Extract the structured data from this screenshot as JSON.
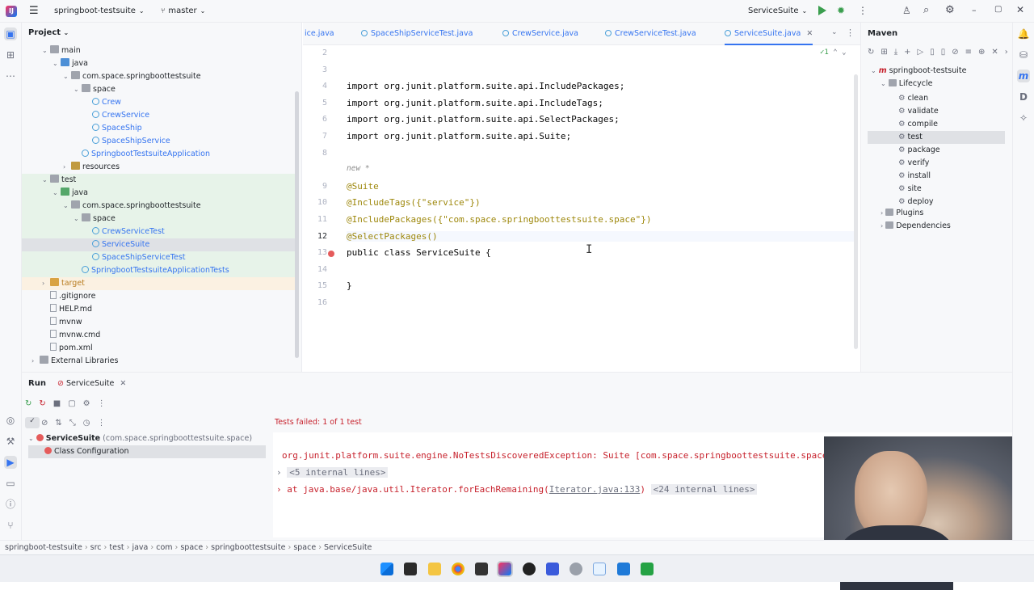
{
  "titlebar": {
    "project": "springboot-testsuite",
    "branch": "master",
    "run_config": "ServiceSuite"
  },
  "project_panel": {
    "title": "Project",
    "tree": [
      {
        "label": "main",
        "indent": 1,
        "type": "folder"
      },
      {
        "label": "java",
        "indent": 2,
        "type": "src"
      },
      {
        "label": "com.space.springboottestsuite",
        "indent": 3,
        "type": "pkg"
      },
      {
        "label": "space",
        "indent": 4,
        "type": "pkg"
      },
      {
        "label": "Crew",
        "indent": 5,
        "type": "class"
      },
      {
        "label": "CrewService",
        "indent": 5,
        "type": "class"
      },
      {
        "label": "SpaceShip",
        "indent": 5,
        "type": "class"
      },
      {
        "label": "SpaceShipService",
        "indent": 5,
        "type": "class"
      },
      {
        "label": "SpringbootTestsuiteApplication",
        "indent": 4,
        "type": "class"
      },
      {
        "label": "resources",
        "indent": 3,
        "type": "res"
      },
      {
        "label": "test",
        "indent": 1,
        "type": "folder"
      },
      {
        "label": "java",
        "indent": 2,
        "type": "test"
      },
      {
        "label": "com.space.springboottestsuite",
        "indent": 3,
        "type": "pkg"
      },
      {
        "label": "space",
        "indent": 4,
        "type": "pkg"
      },
      {
        "label": "CrewServiceTest",
        "indent": 5,
        "type": "class"
      },
      {
        "label": "ServiceSuite",
        "indent": 5,
        "type": "class"
      },
      {
        "label": "SpaceShipServiceTest",
        "indent": 5,
        "type": "class"
      },
      {
        "label": "SpringbootTestsuiteApplicationTests",
        "indent": 4,
        "type": "class"
      },
      {
        "label": "target",
        "indent": 1,
        "type": "tgt"
      },
      {
        "label": ".gitignore",
        "indent": 1,
        "type": "file"
      },
      {
        "label": "HELP.md",
        "indent": 1,
        "type": "file"
      },
      {
        "label": "mvnw",
        "indent": 1,
        "type": "file"
      },
      {
        "label": "mvnw.cmd",
        "indent": 1,
        "type": "file"
      },
      {
        "label": "pom.xml",
        "indent": 1,
        "type": "file"
      },
      {
        "label": "External Libraries",
        "indent": 0,
        "type": "lib"
      }
    ]
  },
  "tabs": [
    "ice.java",
    "SpaceShipServiceTest.java",
    "CrewService.java",
    "CrewServiceTest.java",
    "ServiceSuite.java"
  ],
  "editor": {
    "inspection_count": "1",
    "lines": [
      {
        "n": "2",
        "text": ""
      },
      {
        "n": "3",
        "text": ""
      },
      {
        "n": "4",
        "text": "import org.junit.platform.suite.api.IncludePackages;"
      },
      {
        "n": "5",
        "text": "import org.junit.platform.suite.api.IncludeTags;"
      },
      {
        "n": "6",
        "text": "import org.junit.platform.suite.api.SelectPackages;"
      },
      {
        "n": "7",
        "text": "import org.junit.platform.suite.api.Suite;"
      },
      {
        "n": "8",
        "text": ""
      },
      {
        "n": "",
        "text": "new *"
      },
      {
        "n": "9",
        "text": "@Suite"
      },
      {
        "n": "10",
        "text": "@IncludeTags({\"service\"})"
      },
      {
        "n": "11",
        "text": "@IncludePackages({\"com.space.springboottestsuite.space\"})"
      },
      {
        "n": "12",
        "text": "@SelectPackages()"
      },
      {
        "n": "13",
        "text": "public class ServiceSuite {"
      },
      {
        "n": "14",
        "text": ""
      },
      {
        "n": "15",
        "text": "}"
      },
      {
        "n": "16",
        "text": ""
      }
    ]
  },
  "maven": {
    "title": "Maven",
    "project": "springboot-testsuite",
    "lifecycle": "Lifecycle",
    "goals": [
      "clean",
      "validate",
      "compile",
      "test",
      "package",
      "verify",
      "install",
      "site",
      "deploy"
    ],
    "plugins": "Plugins",
    "dependencies": "Dependencies"
  },
  "run": {
    "tab_run": "Run",
    "tab_config": "ServiceSuite",
    "status": "Tests failed: 1 of 1 test",
    "tree_root": "ServiceSuite",
    "tree_root_pkg": "(com.space.springboottestsuite.space)",
    "tree_child": "Class Configuration",
    "console_line1": "org.junit.platform.suite.engine.NoTestsDiscoveredException: Suite [com.space.springboottestsuite.space.Se",
    "console_line2": "<5 internal lines>",
    "console_line3_pre": "at java.base/java.util.Iterator.forEachRemaining(",
    "console_line3_link": "Iterator.java:133",
    "console_line3_post": ")",
    "console_line3_more": "<24 internal lines>"
  },
  "breadcrumb": [
    "springboot-testsuite",
    "src",
    "test",
    "java",
    "com",
    "space",
    "springboottestsuite",
    "space",
    "ServiceSuite"
  ]
}
